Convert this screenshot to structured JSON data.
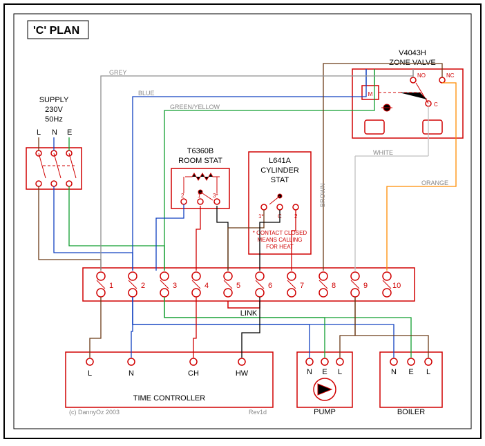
{
  "title": "'C' PLAN",
  "supply": {
    "label": "SUPPLY",
    "voltage": "230V",
    "freq": "50Hz",
    "L": "L",
    "N": "N",
    "E": "E"
  },
  "roomstat": {
    "model": "T6360B",
    "name": "ROOM STAT",
    "t1": "2",
    "t2": "1",
    "t3": "3*"
  },
  "cylstat": {
    "model": "L641A",
    "name1": "CYLINDER",
    "name2": "STAT",
    "t1": "1*",
    "c": "C",
    "t2": "2",
    "note1": "* CONTACT CLOSED",
    "note2": "MEANS CALLING",
    "note3": "FOR HEAT"
  },
  "zonevalve": {
    "model": "V4043H",
    "name": "ZONE VALVE",
    "M": "M",
    "NO": "NO",
    "NC": "NC",
    "C": "C"
  },
  "strip": {
    "link": "LINK",
    "n": [
      "1",
      "2",
      "3",
      "4",
      "5",
      "6",
      "7",
      "8",
      "9",
      "10"
    ]
  },
  "timectl": {
    "name": "TIME CONTROLLER",
    "L": "L",
    "N": "N",
    "CH": "CH",
    "HW": "HW"
  },
  "pump": {
    "name": "PUMP",
    "N": "N",
    "E": "E",
    "L": "L"
  },
  "boiler": {
    "name": "BOILER",
    "N": "N",
    "E": "E",
    "L": "L"
  },
  "wires": {
    "grey": "GREY",
    "blue": "BLUE",
    "greenyellow": "GREEN/YELLOW",
    "brown": "BROWN",
    "white": "WHITE",
    "orange": "ORANGE"
  },
  "meta": {
    "copyright": "(c) DannyOz 2003",
    "rev": "Rev1d"
  }
}
